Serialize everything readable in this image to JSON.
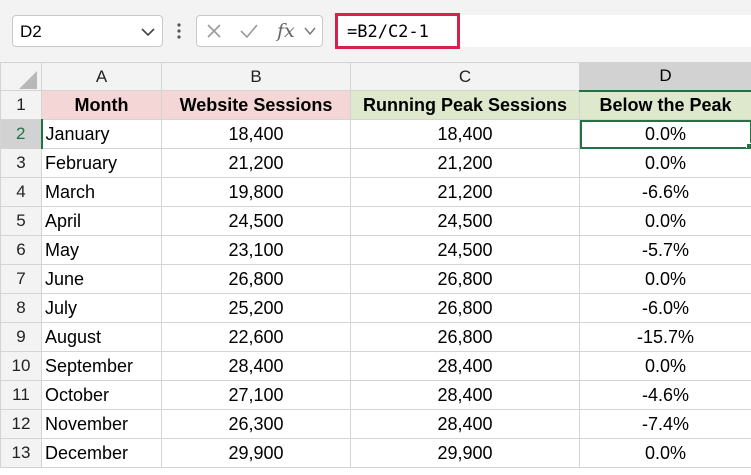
{
  "name_box": {
    "value": "D2"
  },
  "formula_bar": {
    "fx_label": "fx",
    "formula": "=B2/C2-1"
  },
  "columns": [
    "A",
    "B",
    "C",
    "D"
  ],
  "header_row": {
    "row_number": "1",
    "cells": [
      "Month",
      "Website Sessions",
      "Running Peak Sessions",
      "Below the Peak"
    ]
  },
  "rows": [
    {
      "n": "2",
      "month": "January",
      "sessions": "18,400",
      "peak": "18,400",
      "below": "0.0%"
    },
    {
      "n": "3",
      "month": "February",
      "sessions": "21,200",
      "peak": "21,200",
      "below": "0.0%"
    },
    {
      "n": "4",
      "month": "March",
      "sessions": "19,800",
      "peak": "21,200",
      "below": "-6.6%"
    },
    {
      "n": "5",
      "month": "April",
      "sessions": "24,500",
      "peak": "24,500",
      "below": "0.0%"
    },
    {
      "n": "6",
      "month": "May",
      "sessions": "23,100",
      "peak": "24,500",
      "below": "-5.7%"
    },
    {
      "n": "7",
      "month": "June",
      "sessions": "26,800",
      "peak": "26,800",
      "below": "0.0%"
    },
    {
      "n": "8",
      "month": "July",
      "sessions": "25,200",
      "peak": "26,800",
      "below": "-6.0%"
    },
    {
      "n": "9",
      "month": "August",
      "sessions": "22,600",
      "peak": "26,800",
      "below": "-15.7%"
    },
    {
      "n": "10",
      "month": "September",
      "sessions": "28,400",
      "peak": "28,400",
      "below": "0.0%"
    },
    {
      "n": "11",
      "month": "October",
      "sessions": "27,100",
      "peak": "28,400",
      "below": "-4.6%"
    },
    {
      "n": "12",
      "month": "November",
      "sessions": "26,300",
      "peak": "28,400",
      "below": "-7.4%"
    },
    {
      "n": "13",
      "month": "December",
      "sessions": "29,900",
      "peak": "29,900",
      "below": "0.0%"
    }
  ],
  "colors": {
    "selection": "#217346",
    "formula_highlight": "#d4224a",
    "header_fill_month_sessions": "#f4d6d6",
    "header_fill_peak_below": "#dde8cc"
  }
}
